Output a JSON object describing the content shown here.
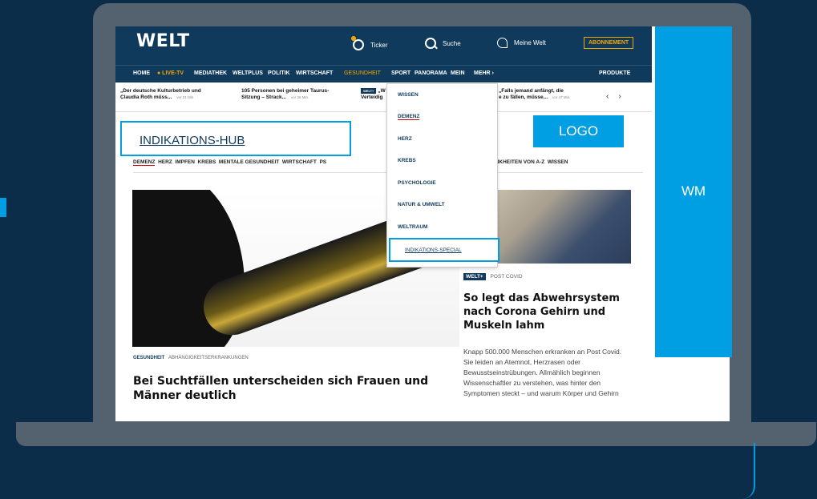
{
  "header": {
    "brand": "WELT",
    "ticker_label": "Ticker",
    "search_label": "Suche",
    "meine_welt_label": "Meine Welt",
    "abo_label": "ABONNEMENT"
  },
  "nav": {
    "items": [
      "HOME",
      "● LIVE-TV",
      "MEDIATHEK",
      "WELTPLUS",
      "POLITIK",
      "WIRTSCHAFT",
      "GESUNDHEIT",
      "SPORT",
      "PANORAMA",
      "MEIN",
      "MEHR ›",
      "PRODUKTE"
    ]
  },
  "teasers": [
    {
      "text1": "„Der deutsche Kulturbetrieb und",
      "text2": "Claudia Roth müss...",
      "time": "vor 21 Min."
    },
    {
      "text1": "105 Personen bei geheimer Taurus-",
      "text2": "Sitzung – Strack...",
      "time": "vor 26 Min."
    },
    {
      "badge": "WELT+",
      "text1": "„W",
      "text2": "Verteidig"
    },
    {
      "text1": "„Falls jemand anfängt, die",
      "text2": "e zu fällen, müsse...",
      "time": "vor 47 Min."
    }
  ],
  "teaser_arrows": {
    "prev": "‹",
    "next": "›"
  },
  "hub": {
    "label": "INDIKATIONS-HUB"
  },
  "logo_placeholder": "LOGO",
  "wm_placeholder": "WM",
  "subnav": {
    "demenz": "DEMENZ",
    "rest": "HERZ  IMPFEN  KREBS  MENTALE GESUNDHEIT  WIRTSCHAFT  PS",
    "right": "ANKHEITEN VON A-Z  WISSEN"
  },
  "dropdown": {
    "items": [
      "WISSEN",
      "DEMENZ",
      "HERZ",
      "KREBS",
      "PSYCHOLOGIE",
      "NATUR & UMWELT",
      "WELTRAUM"
    ],
    "special": "INDIKATIONS-SPECIAL"
  },
  "main_article": {
    "kicker_bold": "GESUNDHEIT",
    "kicker": "ABHÄNGIGKEITSERKRANKUNGEN",
    "headline": "Bei Suchtfällen unterscheiden sich Frauen und Männer deutlich"
  },
  "side_article": {
    "badge": "WELT+",
    "kicker": "POST COVID",
    "headline": "So legt das Abwehrsystem nach Corona Gehirn und Muskeln lahm",
    "body": "Knapp 500.000 Menschen erkranken an Post Covid. Sie leiden an Atemnot, Herzrasen oder Bewusstseinstrübungen. Allmählich beginnen Wissenschaftler zu verstehen, was hinter den Symptomen steckt – und warum Körper und Gehirn"
  },
  "colors": {
    "accent": "#009fe3",
    "header": "#0f3a5b",
    "live": "#f7a600",
    "background": "#0c2d4a"
  }
}
